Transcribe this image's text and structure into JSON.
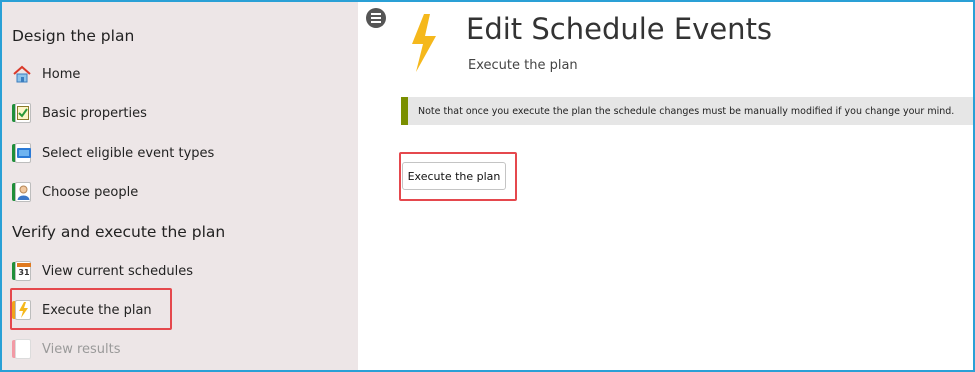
{
  "sidebar": {
    "sections": [
      {
        "title": "Design the plan",
        "items": [
          {
            "label": "Home",
            "icon": "home-icon"
          },
          {
            "label": "Basic properties",
            "icon": "clipboard-icon"
          },
          {
            "label": "Select eligible event types",
            "icon": "card-icon"
          },
          {
            "label": "Choose people",
            "icon": "person-icon"
          }
        ]
      },
      {
        "title": "Verify and execute the plan",
        "items": [
          {
            "label": "View current schedules",
            "icon": "calendar-icon",
            "icon_text": "31"
          },
          {
            "label": "Execute the plan",
            "icon": "lightning-icon",
            "selected": true
          },
          {
            "label": "View results",
            "icon": "page-icon",
            "disabled": true
          }
        ]
      }
    ]
  },
  "header": {
    "title": "Edit Schedule Events",
    "subtitle": "Execute the plan"
  },
  "note": {
    "text": "Note that once you execute the plan the schedule changes must be manually modified if you change your mind."
  },
  "actions": {
    "execute_label": "Execute the plan"
  },
  "colors": {
    "frame": "#2aa0d6",
    "sidebar_bg": "#ede6e7",
    "highlight": "#e5484d",
    "note_accent": "#7a8f00",
    "bolt": "#f5b81c",
    "spine_green": "#1f8f3a",
    "spine_orange": "#f0a51c",
    "spine_pink": "#f29aa5"
  }
}
